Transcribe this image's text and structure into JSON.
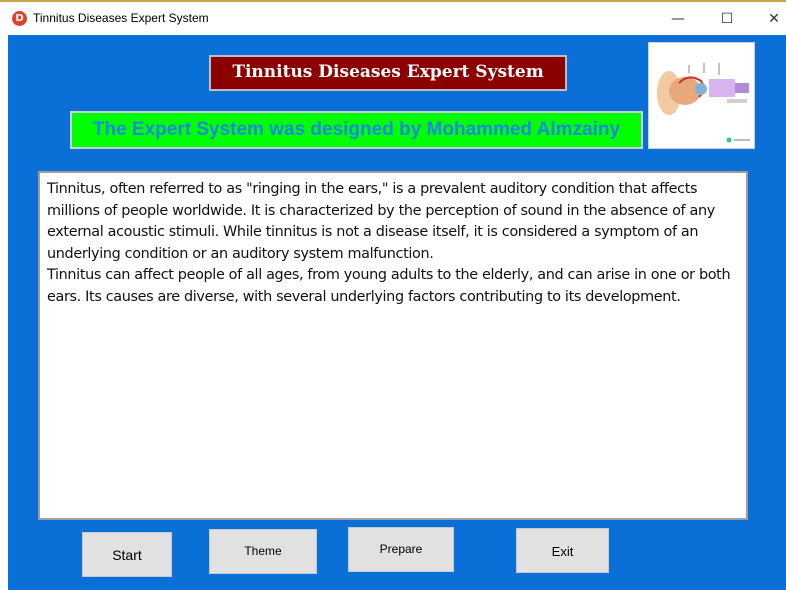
{
  "window": {
    "title": "Tinnitus Diseases Expert System",
    "icon": "app-d-icon",
    "icon_letter": "D",
    "controls": {
      "minimize": "—",
      "maximize": "☐",
      "close": "✕"
    }
  },
  "header": {
    "title": "Tinnitus Diseases Expert System",
    "credit": "The Expert System was designed by Mohammed Almzainy"
  },
  "image": {
    "icon": "ear-anatomy-image"
  },
  "description": "Tinnitus, often referred to as \"ringing in the ears,\" is a prevalent auditory condition that affects millions of people worldwide. It is characterized by the perception of sound in the absence of any external acoustic stimuli. While tinnitus is not a disease itself, it is considered a symptom of an underlying condition or an auditory system malfunction.\nTinnitus can affect people of all ages, from young adults to the elderly, and can arise in one or both ears. Its causes are diverse, with several underlying factors contributing to its development.",
  "buttons": {
    "start": "Start",
    "theme": "Theme",
    "prepare": "Prepare",
    "exit": "Exit"
  },
  "colors": {
    "client_bg": "#0b6fd8",
    "banner_bg": "#8b0000",
    "credit_bg": "#00ff00",
    "credit_text": "#1e88e5"
  }
}
